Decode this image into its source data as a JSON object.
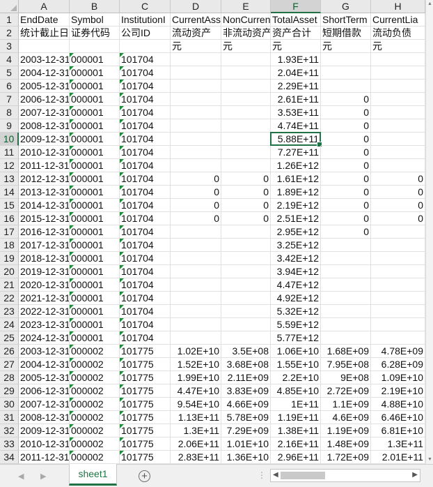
{
  "sheet": {
    "columns": [
      "A",
      "B",
      "C",
      "D",
      "E",
      "F",
      "G",
      "H"
    ],
    "selected_column": "F",
    "active_cell": "F10",
    "rows": [
      {
        "num": "1",
        "cells": [
          "EndDate",
          "Symbol",
          "InstitutionI",
          "CurrentAss",
          "NonCurren",
          "TotalAsset",
          "ShortTerm",
          "CurrentLia"
        ]
      },
      {
        "num": "2",
        "cells": [
          "统计截止日期",
          "证券代码",
          "公司ID",
          "流动资产",
          "非流动资产",
          "资产合计",
          "短期借款",
          "流动负债"
        ]
      },
      {
        "num": "3",
        "cells": [
          "",
          "",
          "",
          "元",
          "元",
          "元",
          "元",
          "元"
        ]
      },
      {
        "num": "4",
        "cells": [
          "2003-12-31",
          "000001",
          "101704",
          "",
          "",
          "1.93E+11",
          "",
          ""
        ]
      },
      {
        "num": "5",
        "cells": [
          "2004-12-31",
          "000001",
          "101704",
          "",
          "",
          "2.04E+11",
          "",
          ""
        ]
      },
      {
        "num": "6",
        "cells": [
          "2005-12-31",
          "000001",
          "101704",
          "",
          "",
          "2.29E+11",
          "",
          ""
        ]
      },
      {
        "num": "7",
        "cells": [
          "2006-12-31",
          "000001",
          "101704",
          "",
          "",
          "2.61E+11",
          "0",
          ""
        ]
      },
      {
        "num": "8",
        "cells": [
          "2007-12-31",
          "000001",
          "101704",
          "",
          "",
          "3.53E+11",
          "0",
          ""
        ]
      },
      {
        "num": "9",
        "cells": [
          "2008-12-31",
          "000001",
          "101704",
          "",
          "",
          "4.74E+11",
          "0",
          ""
        ]
      },
      {
        "num": "10",
        "cells": [
          "2009-12-31",
          "000001",
          "101704",
          "",
          "",
          "5.88E+11",
          "0",
          ""
        ]
      },
      {
        "num": "11",
        "cells": [
          "2010-12-31",
          "000001",
          "101704",
          "",
          "",
          "7.27E+11",
          "0",
          ""
        ]
      },
      {
        "num": "12",
        "cells": [
          "2011-12-31",
          "000001",
          "101704",
          "",
          "",
          "1.26E+12",
          "0",
          ""
        ]
      },
      {
        "num": "13",
        "cells": [
          "2012-12-31",
          "000001",
          "101704",
          "0",
          "0",
          "1.61E+12",
          "0",
          "0"
        ]
      },
      {
        "num": "14",
        "cells": [
          "2013-12-31",
          "000001",
          "101704",
          "0",
          "0",
          "1.89E+12",
          "0",
          "0"
        ]
      },
      {
        "num": "15",
        "cells": [
          "2014-12-31",
          "000001",
          "101704",
          "0",
          "0",
          "2.19E+12",
          "0",
          "0"
        ]
      },
      {
        "num": "16",
        "cells": [
          "2015-12-31",
          "000001",
          "101704",
          "0",
          "0",
          "2.51E+12",
          "0",
          "0"
        ]
      },
      {
        "num": "17",
        "cells": [
          "2016-12-31",
          "000001",
          "101704",
          "",
          "",
          "2.95E+12",
          "0",
          ""
        ]
      },
      {
        "num": "18",
        "cells": [
          "2017-12-31",
          "000001",
          "101704",
          "",
          "",
          "3.25E+12",
          "",
          ""
        ]
      },
      {
        "num": "19",
        "cells": [
          "2018-12-31",
          "000001",
          "101704",
          "",
          "",
          "3.42E+12",
          "",
          ""
        ]
      },
      {
        "num": "20",
        "cells": [
          "2019-12-31",
          "000001",
          "101704",
          "",
          "",
          "3.94E+12",
          "",
          ""
        ]
      },
      {
        "num": "21",
        "cells": [
          "2020-12-31",
          "000001",
          "101704",
          "",
          "",
          "4.47E+12",
          "",
          ""
        ]
      },
      {
        "num": "22",
        "cells": [
          "2021-12-31",
          "000001",
          "101704",
          "",
          "",
          "4.92E+12",
          "",
          ""
        ]
      },
      {
        "num": "23",
        "cells": [
          "2022-12-31",
          "000001",
          "101704",
          "",
          "",
          "5.32E+12",
          "",
          ""
        ]
      },
      {
        "num": "24",
        "cells": [
          "2023-12-31",
          "000001",
          "101704",
          "",
          "",
          "5.59E+12",
          "",
          ""
        ]
      },
      {
        "num": "25",
        "cells": [
          "2024-12-31",
          "000001",
          "101704",
          "",
          "",
          "5.77E+12",
          "",
          ""
        ]
      },
      {
        "num": "26",
        "cells": [
          "2003-12-31",
          "000002",
          "101775",
          "1.02E+10",
          "3.5E+08",
          "1.06E+10",
          "1.68E+09",
          "4.78E+09"
        ]
      },
      {
        "num": "27",
        "cells": [
          "2004-12-31",
          "000002",
          "101775",
          "1.52E+10",
          "3.68E+08",
          "1.55E+10",
          "7.95E+08",
          "6.28E+09"
        ]
      },
      {
        "num": "28",
        "cells": [
          "2005-12-31",
          "000002",
          "101775",
          "1.99E+10",
          "2.11E+09",
          "2.2E+10",
          "9E+08",
          "1.09E+10"
        ]
      },
      {
        "num": "29",
        "cells": [
          "2006-12-31",
          "000002",
          "101775",
          "4.47E+10",
          "3.83E+09",
          "4.85E+10",
          "2.72E+09",
          "2.19E+10"
        ]
      },
      {
        "num": "30",
        "cells": [
          "2007-12-31",
          "000002",
          "101775",
          "9.54E+10",
          "4.66E+09",
          "1E+11",
          "1.1E+09",
          "4.88E+10"
        ]
      },
      {
        "num": "31",
        "cells": [
          "2008-12-31",
          "000002",
          "101775",
          "1.13E+11",
          "5.78E+09",
          "1.19E+11",
          "4.6E+09",
          "6.46E+10"
        ]
      },
      {
        "num": "32",
        "cells": [
          "2009-12-31",
          "000002",
          "101775",
          "1.3E+11",
          "7.29E+09",
          "1.38E+11",
          "1.19E+09",
          "6.81E+10"
        ]
      },
      {
        "num": "33",
        "cells": [
          "2010-12-31",
          "000002",
          "101775",
          "2.06E+11",
          "1.01E+10",
          "2.16E+11",
          "1.48E+09",
          "1.3E+11"
        ]
      },
      {
        "num": "34",
        "cells": [
          "2011-12-31",
          "000002",
          "101775",
          "2.83E+11",
          "1.36E+10",
          "2.96E+11",
          "1.72E+09",
          "2.01E+11"
        ]
      }
    ]
  },
  "tabs": {
    "sheet_name": "sheet1",
    "add_icon": "plus-circle-icon",
    "more_icon": "ellipsis-icon"
  },
  "scroll": {
    "up_icon": "triangle-up-icon",
    "down_icon": "triangle-down-icon",
    "left_icon": "triangle-left-icon",
    "right_icon": "triangle-right-icon"
  },
  "colors": {
    "accent": "#217346",
    "header_bg": "#e9e9e9",
    "selected_header_bg": "#d3d3d3",
    "gridline": "#e1e1e1"
  }
}
